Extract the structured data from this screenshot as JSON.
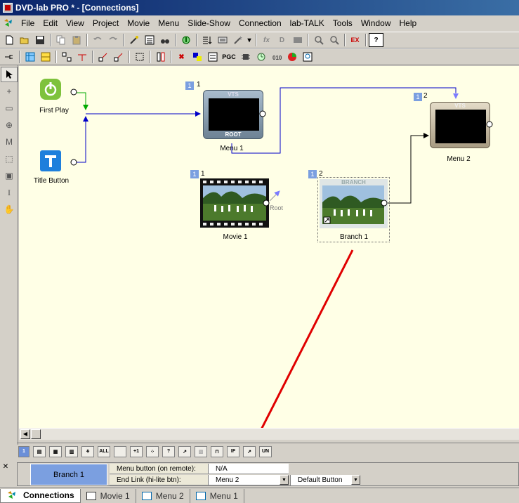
{
  "window": {
    "title": "DVD-lab PRO * - [Connections]"
  },
  "menu": [
    "File",
    "Edit",
    "View",
    "Project",
    "Movie",
    "Menu",
    "Slide-Show",
    "Connection",
    "lab-TALK",
    "Tools",
    "Window",
    "Help"
  ],
  "toolbar2": {
    "pgc_label": "PGC"
  },
  "nodes": {
    "first_play": {
      "label": "First Play"
    },
    "title_button": {
      "label": "Title Button"
    },
    "menu1": {
      "label": "Menu 1",
      "num": "1",
      "badge": "1",
      "vts": "VTS",
      "root": "ROOT"
    },
    "menu2": {
      "label": "Menu 2",
      "num": "2",
      "badge": "1",
      "vts": "VTS"
    },
    "movie1": {
      "label": "Movie 1",
      "num": "1",
      "badge": "1",
      "root_link": "Root"
    },
    "branch1": {
      "label": "Branch 1",
      "num": "2",
      "badge": "1",
      "branch": "BRANCH"
    }
  },
  "bottom_tools": {
    "sel": "1",
    "all": "ALL",
    "plus1": "+1",
    "un": "UN"
  },
  "properties": {
    "object_name": "Branch 1",
    "rows": [
      {
        "label": "Menu button (on remote):",
        "value": "N/A"
      },
      {
        "label": "End Link (hi-lite btn):",
        "value": "Menu 2",
        "value2": "Default Button"
      }
    ]
  },
  "tabs": [
    "Connections",
    "Movie 1",
    "Menu 2",
    "Menu 1"
  ],
  "colors": {
    "titlebar": "#0a246a",
    "canvas": "#ffffe6",
    "link_blue": "#0000c8",
    "arrow_red": "#e00000"
  }
}
